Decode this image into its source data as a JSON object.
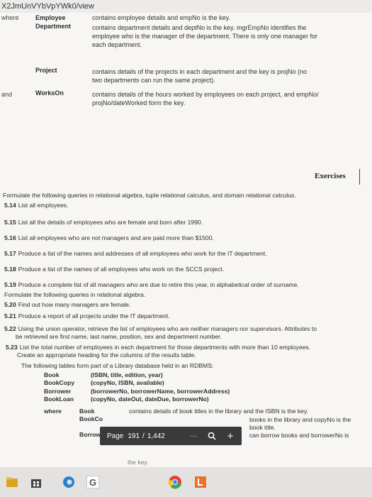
{
  "browser": {
    "url": "X2JmUnVYbVpYWk0/view"
  },
  "definitions": {
    "left_fragments": [
      "where",
      "and"
    ],
    "rows": [
      {
        "name": "Employee",
        "text": [
          "contains employee details and empNo is the key."
        ]
      },
      {
        "name": "Department",
        "text": [
          "contains department details and deptNo is the key. mgrEmpNo identifies the",
          "employee who is the manager of the department. There is only one manager for",
          "each department."
        ]
      },
      {
        "name": "Project",
        "text": [
          "contains details of the projects in each department and the key is projNo (no",
          "two departments can run the same project)."
        ]
      },
      {
        "name": "WorksOn",
        "text": [
          "contains details of the hours worked by employees on each project, and empNo/",
          "projNo/dateWorked form the key."
        ]
      }
    ]
  },
  "exercises": {
    "title": "Exercises",
    "intro": "Formulate the following queries in relational algebra, tuple relational calculus, and domain relational calculus.",
    "items": [
      {
        "num": "5.14",
        "text": "List all employees."
      },
      {
        "num": "5.15",
        "text": "List all the details of employees who are female and born after 1990."
      },
      {
        "num": "5.16",
        "text": "List all employees who are not managers and are paid more than $1500."
      },
      {
        "num": "5.17",
        "text": "Produce a list of the names and addresses of all employees who work for the IT department."
      },
      {
        "num": "5.18",
        "text": "Produce a list of the names of all employees who work on the SCCS project."
      },
      {
        "num": "5.19",
        "text": "Produce a complete list of all managers who are due to retire this year, in alphabetical order of surname."
      }
    ],
    "intro2": "Formulate the following queries in relational algebra.",
    "items2": [
      {
        "num": "5.20",
        "text": "Find out how many managers are female."
      },
      {
        "num": "5.21",
        "text": "Produce a report of all projects under the IT department."
      },
      {
        "num": "5.22",
        "text": "Using the union operator, retrieve the list of employees who are neither managers nor supervisors. Attributes to",
        "text2": "be retrieved are first name, last name, position, sex and department number."
      },
      {
        "num": "5.23",
        "text": "List the total number of employees in each department for those departments with more than 10 employees.",
        "text2": "Create an appropriate heading for the columns of the results table."
      }
    ],
    "library_intro": "The following tables form part of a Library database held in an RDBMS:",
    "library_tables": [
      {
        "name": "Book",
        "schema": "(ISBN, title, edition, year)"
      },
      {
        "name": "BookCopy",
        "schema": "(copyNo, ISBN, available)"
      },
      {
        "name": "Borrower",
        "schema": "(borrowerNo, borrowerName, borrowerAddress)"
      },
      {
        "name": "BookLoan",
        "schema": "(copyNo, dateOut, dateDue, borrowerNo)"
      }
    ],
    "where_label": "where",
    "where_rows": [
      {
        "name": "Book",
        "text": "contains details of book titles in the library and the ISBN is the key."
      },
      {
        "name": "BookCo",
        "text": "books in the library and copyNo is the"
      },
      {
        "name": "",
        "text": "book title."
      },
      {
        "name": "Borrow",
        "text": "can borrow books and borrowerNo is"
      },
      {
        "name": "",
        "text": "the key."
      }
    ]
  },
  "pdf_toolbar": {
    "page_label": "Page",
    "current_page": "191",
    "separator": "/",
    "total_pages": "1,442",
    "zoom_out": "—",
    "zoom_icon": "magnifier-icon",
    "zoom_in": "+"
  },
  "taskbar": {
    "items": [
      "file-explorer-icon",
      "store-icon",
      "edge-icon",
      "google-icon",
      "chrome-icon",
      "app-icon"
    ]
  }
}
